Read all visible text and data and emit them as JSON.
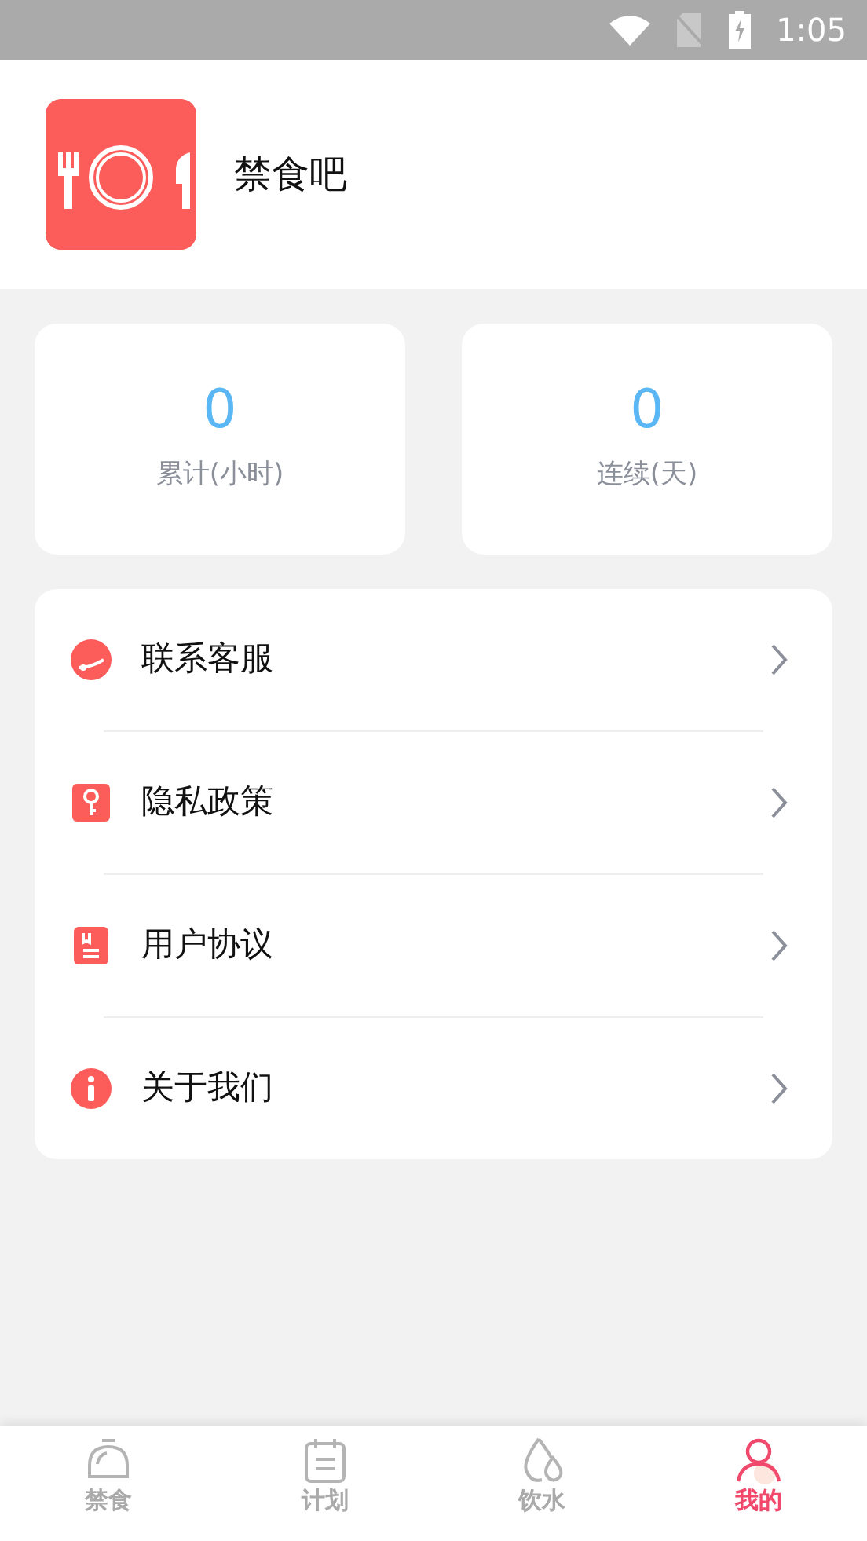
{
  "status_bar": {
    "time": "1:05"
  },
  "profile": {
    "name": "禁食吧"
  },
  "stats": [
    {
      "value": "0",
      "label": "累计(小时)"
    },
    {
      "value": "0",
      "label": "连续(天)"
    }
  ],
  "menu": [
    {
      "kind": "service",
      "label": "联系客服"
    },
    {
      "kind": "privacy",
      "label": "隐私政策"
    },
    {
      "kind": "agreement",
      "label": "用户协议"
    },
    {
      "kind": "about",
      "label": "关于我们"
    }
  ],
  "tabs": [
    {
      "kind": "fast",
      "label": "禁食",
      "selected": false
    },
    {
      "kind": "plan",
      "label": "计划",
      "selected": false
    },
    {
      "kind": "water",
      "label": "饮水",
      "selected": false
    },
    {
      "kind": "me",
      "label": "我的",
      "selected": true
    }
  ]
}
